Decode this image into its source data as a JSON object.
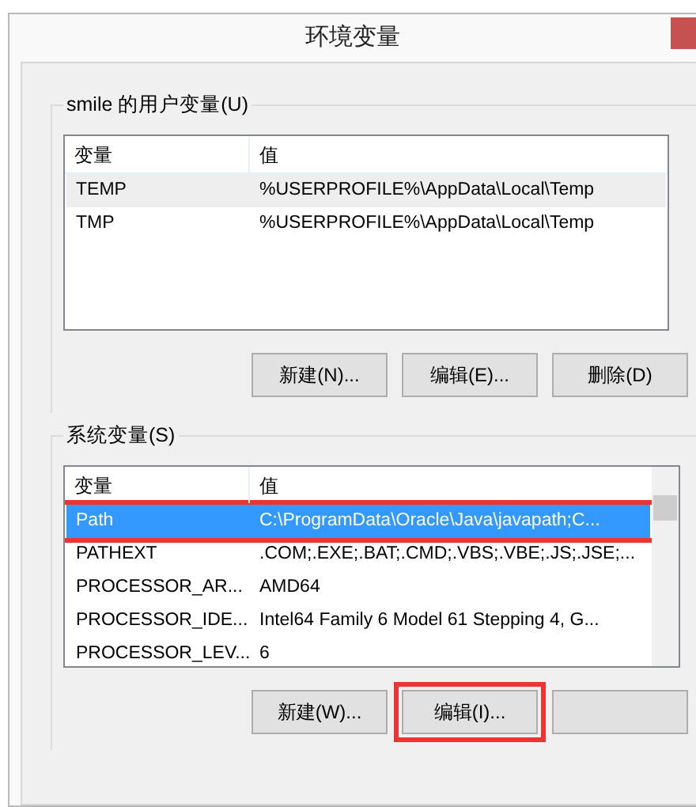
{
  "window": {
    "title": "环境变量"
  },
  "user_vars": {
    "label": "smile 的用户变量(U)",
    "columns": [
      "变量",
      "值"
    ],
    "rows": [
      {
        "name": "TEMP",
        "value": "%USERPROFILE%\\AppData\\Local\\Temp",
        "selected": false,
        "hover": true
      },
      {
        "name": "TMP",
        "value": "%USERPROFILE%\\AppData\\Local\\Temp",
        "selected": false,
        "hover": false
      }
    ],
    "buttons": [
      {
        "label": "新建(N)...",
        "highlighted": false
      },
      {
        "label": "编辑(E)...",
        "highlighted": false
      },
      {
        "label": "删除(D)",
        "highlighted": false
      }
    ]
  },
  "system_vars": {
    "label": "系统变量(S)",
    "columns": [
      "变量",
      "值"
    ],
    "rows": [
      {
        "name": "Path",
        "value": "C:\\ProgramData\\Oracle\\Java\\javapath;C...",
        "selected": true,
        "highlighted": true
      },
      {
        "name": "PATHEXT",
        "value": ".COM;.EXE;.BAT;.CMD;.VBS;.VBE;.JS;.JSE;...",
        "selected": false,
        "highlighted": false
      },
      {
        "name": "PROCESSOR_AR...",
        "value": "AMD64",
        "selected": false,
        "highlighted": false
      },
      {
        "name": "PROCESSOR_IDE...",
        "value": "Intel64 Family 6 Model 61 Stepping 4, G...",
        "selected": false,
        "highlighted": false
      },
      {
        "name": "PROCESSOR_LEV...",
        "value": "6",
        "selected": false,
        "highlighted": false
      }
    ],
    "buttons": [
      {
        "label": "新建(W)...",
        "highlighted": false
      },
      {
        "label": "编辑(I)...",
        "highlighted": true
      },
      {
        "highlighted": false
      }
    ]
  }
}
